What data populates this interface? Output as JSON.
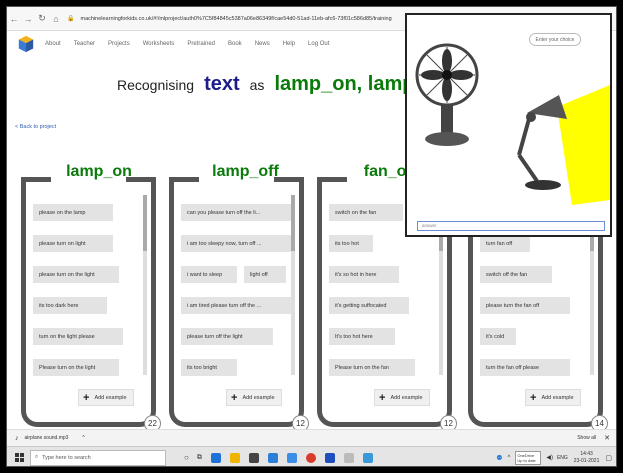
{
  "browser": {
    "url": "machinelearningforkids.co.uk/#!/mlproject/auth0%7C5f84845c5387a06e86349f/cae54d0-51ad-11eb-afc6-73f01c586d85/training"
  },
  "nav": {
    "items": [
      "About",
      "Teacher",
      "Projects",
      "Worksheets",
      "Pretrained",
      "Book",
      "News",
      "Help",
      "Log Out"
    ]
  },
  "header": {
    "w1": "Recognising",
    "w2": "text",
    "w3": "as",
    "w4": "lamp_on, lamp_off or 2"
  },
  "back_link": "< Back to project",
  "buckets": [
    {
      "title": "lamp_on",
      "items": [
        "please on the lamp",
        "please turn on light",
        "please turn on the light",
        "its too dark here",
        "turn on the light please",
        "Please turn on the light"
      ],
      "add_label": "Add example",
      "count": "22"
    },
    {
      "title": "lamp_off",
      "items": [
        "can you please turn off the li...",
        "i am too sleepy now, turn off ...",
        "i want to sleep",
        "i am tired please turn off the ...",
        "please turn off the light",
        "its too bright"
      ],
      "extra_chip": "light off",
      "add_label": "Add example",
      "count": "12"
    },
    {
      "title": "fan_on",
      "items": [
        "switch on the fan",
        "its too hot",
        "it's so hot in here",
        "it's getting suffocated",
        "It's too hot here",
        "Please turn on the fan"
      ],
      "add_label": "Add example",
      "count": "12"
    },
    {
      "title": "",
      "items": [
        "turn fan off",
        "switch off the fan",
        "please turn the fan off",
        "it's cold",
        "turn the fan off please"
      ],
      "add_label": "Add example",
      "count": "14"
    }
  ],
  "popup": {
    "prompt": "Enter your choice",
    "input_placeholder": "answer"
  },
  "download": {
    "file": "airplane sound.mp3",
    "show_all": "Show all"
  },
  "taskbar": {
    "search_placeholder": "Type here to search",
    "onedrive": "OneDrive",
    "onedrive_sub": "Up to date",
    "lang": "ENG",
    "time": "14:43",
    "date": "23-01-2021"
  }
}
